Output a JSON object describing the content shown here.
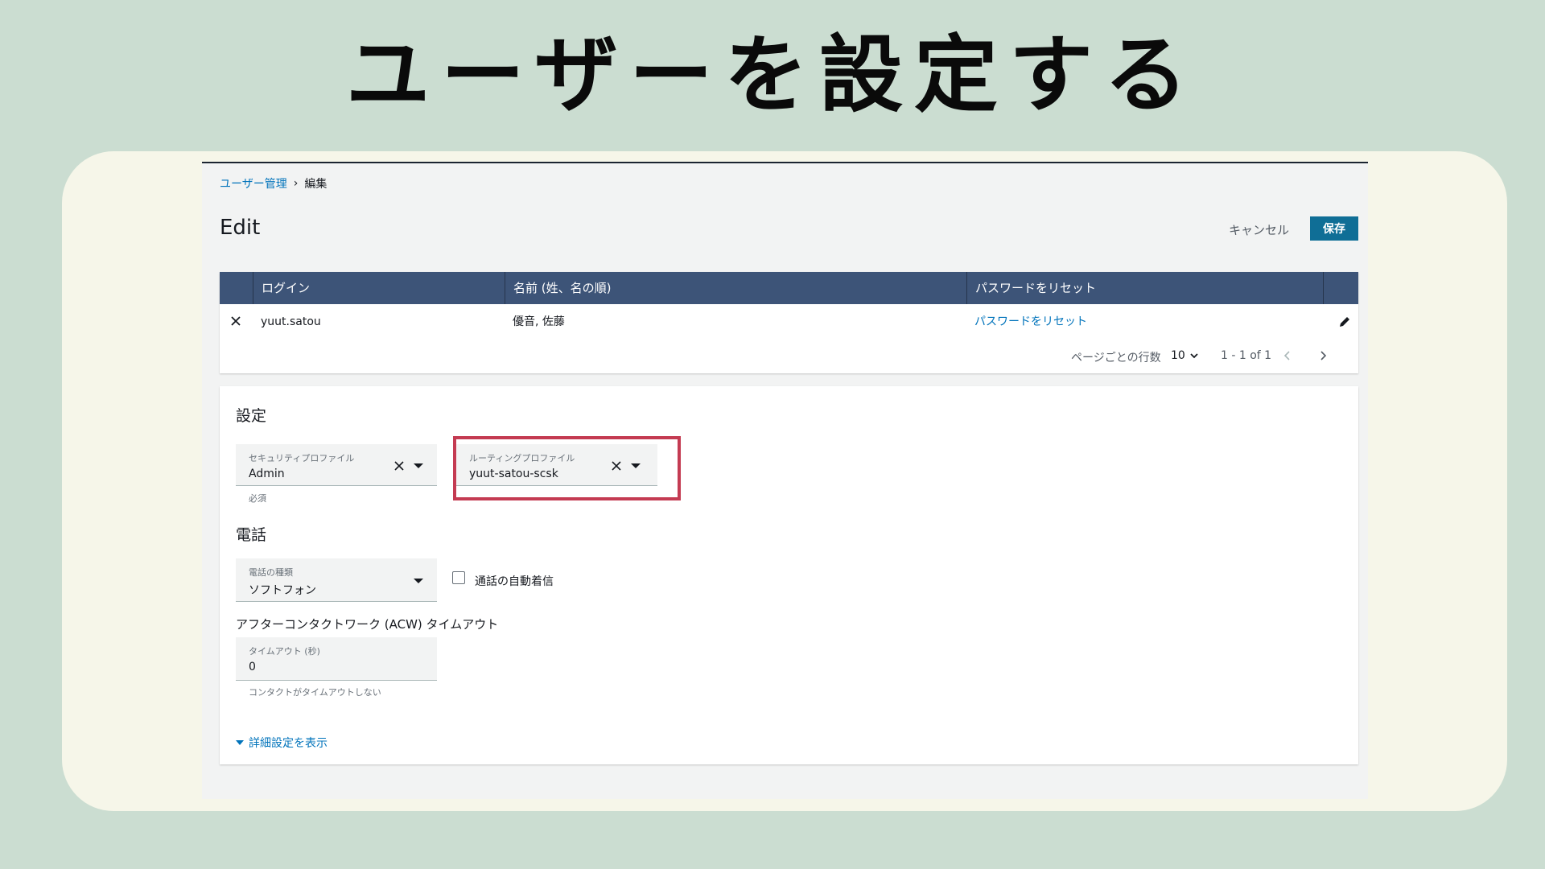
{
  "slide": {
    "title": "ユーザーを設定する"
  },
  "breadcrumb": {
    "parent": "ユーザー管理",
    "separator": "›",
    "current": "編集"
  },
  "page": {
    "title": "Edit",
    "cancel_label": "キャンセル",
    "save_label": "保存"
  },
  "users_table": {
    "columns": [
      "ログイン",
      "名前 (姓、名の順)",
      "パスワードをリセット"
    ],
    "rows": [
      {
        "login": "yuut.satou",
        "name": "優音, 佐藤",
        "reset": "パスワードをリセット"
      }
    ],
    "pager": {
      "rows_per_page_label": "ページごとの行数",
      "rows_per_page": "10",
      "range": "1 - 1 of 1"
    }
  },
  "settings": {
    "title": "設定",
    "security_profile": {
      "label": "セキュリティプロファイル",
      "value": "Admin",
      "hint": "必須"
    },
    "routing_profile": {
      "label": "ルーティングプロファイル",
      "value": "yuut-satou-scsk"
    },
    "phone_title": "電話",
    "phone_type": {
      "label": "電話の種類",
      "value": "ソフトフォン"
    },
    "auto_accept_label": "通話の自動着信",
    "acw_title": "アフターコンタクトワーク (ACW) タイムアウト",
    "timeout": {
      "label": "タイムアウト (秒)",
      "value": "0",
      "hint": "コンタクトがタイムアウトしない"
    },
    "advanced_label": "詳細設定を表示"
  },
  "colors": {
    "primary": "#0f6e96",
    "link": "#0073bb",
    "header": "#3d5478",
    "highlight": "#c43b52"
  }
}
